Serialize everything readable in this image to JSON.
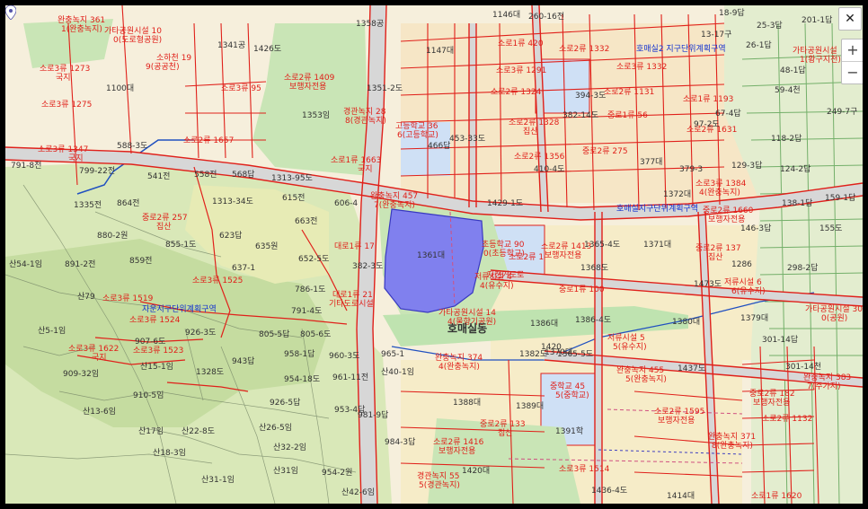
{
  "controls": {
    "close_glyph": "✕",
    "zoom_in_glyph": "+",
    "zoom_out_glyph": "−"
  },
  "colors": {
    "background": "#f6efdc",
    "hill": "#cfe0b0",
    "park": "#bfe3b0",
    "school_site": "#cfe0f5",
    "road_fill": "#e8e8e8",
    "road_line": "#e0201a",
    "selected_parcel": "#8080ee",
    "farmland_line": "#58a050",
    "stream": "#2050c0"
  },
  "labels": [
    {
      "id": "l1",
      "text": "완충녹지 361",
      "style": "red"
    },
    {
      "id": "l2",
      "text": "1(완충녹지)",
      "style": "red"
    },
    {
      "id": "l3",
      "text": "가타공원시설 10",
      "style": "red"
    },
    {
      "id": "l4",
      "text": "0(도로형공원)",
      "style": "red"
    },
    {
      "id": "l5",
      "text": "소로3류 1273",
      "style": "red"
    },
    {
      "id": "l6",
      "text": "국지",
      "style": "red"
    },
    {
      "id": "l7",
      "text": "소하천 19",
      "style": "red"
    },
    {
      "id": "l8",
      "text": "9(공공천)",
      "style": "red"
    },
    {
      "id": "l9",
      "text": "소로3류 1275",
      "style": "red"
    },
    {
      "id": "l10",
      "text": "소로3류 95",
      "style": "red"
    },
    {
      "id": "l11",
      "text": "소로2류 1409",
      "style": "red"
    },
    {
      "id": "l12",
      "text": "보행자전용",
      "style": "red"
    },
    {
      "id": "l13",
      "text": "1341공",
      "style": "dark"
    },
    {
      "id": "l14",
      "text": "1426도",
      "style": "dark"
    },
    {
      "id": "l15",
      "text": "1100대",
      "style": "dark"
    },
    {
      "id": "l16",
      "text": "1358공",
      "style": "dark"
    },
    {
      "id": "l17",
      "text": "1353임",
      "style": "dark"
    },
    {
      "id": "l18",
      "text": "1351-2도",
      "style": "dark"
    },
    {
      "id": "l19",
      "text": "1147대",
      "style": "dark"
    },
    {
      "id": "l20",
      "text": "1146대",
      "style": "dark"
    },
    {
      "id": "l21",
      "text": "260-16전",
      "style": "dark"
    },
    {
      "id": "l22",
      "text": "경관녹지 28",
      "style": "red"
    },
    {
      "id": "l23",
      "text": "8(경관녹지)",
      "style": "red"
    },
    {
      "id": "l24",
      "text": "소로2류 1657",
      "style": "red"
    },
    {
      "id": "l25",
      "text": "소로3류 1347",
      "style": "red"
    },
    {
      "id": "l26",
      "text": "국지",
      "style": "red"
    },
    {
      "id": "l27",
      "text": "588-3도",
      "style": "dark"
    },
    {
      "id": "l28",
      "text": "791-8전",
      "style": "dark"
    },
    {
      "id": "l29",
      "text": "799-22전",
      "style": "dark"
    },
    {
      "id": "l30",
      "text": "541전",
      "style": "dark"
    },
    {
      "id": "l31",
      "text": "558전",
      "style": "dark"
    },
    {
      "id": "l32",
      "text": "568답",
      "style": "dark"
    },
    {
      "id": "l33",
      "text": "1313-95도",
      "style": "dark"
    },
    {
      "id": "l34",
      "text": "1335전",
      "style": "dark"
    },
    {
      "id": "l35",
      "text": "864전",
      "style": "dark"
    },
    {
      "id": "l36",
      "text": "1313-34도",
      "style": "dark"
    },
    {
      "id": "l37",
      "text": "615전",
      "style": "dark"
    },
    {
      "id": "l38",
      "text": "606-4",
      "style": "dark"
    },
    {
      "id": "l39",
      "text": "소로1류 1663",
      "style": "red"
    },
    {
      "id": "l40",
      "text": "국지",
      "style": "red"
    },
    {
      "id": "l41",
      "text": "고등학교 36",
      "style": "red"
    },
    {
      "id": "l42",
      "text": "6(고등학교)",
      "style": "red"
    },
    {
      "id": "l43",
      "text": "완충녹지 457",
      "style": "red"
    },
    {
      "id": "l44",
      "text": "7(완충녹지)",
      "style": "red"
    },
    {
      "id": "l45",
      "text": "중로2류 257",
      "style": "red"
    },
    {
      "id": "l46",
      "text": "집산",
      "style": "red"
    },
    {
      "id": "l47",
      "text": "880-2원",
      "style": "dark"
    },
    {
      "id": "l48",
      "text": "623답",
      "style": "dark"
    },
    {
      "id": "l49",
      "text": "663전",
      "style": "dark"
    },
    {
      "id": "l50",
      "text": "635원",
      "style": "dark"
    },
    {
      "id": "l51",
      "text": "855-1도",
      "style": "dark"
    },
    {
      "id": "l52",
      "text": "산54-1임",
      "style": "dark"
    },
    {
      "id": "l53",
      "text": "891-2전",
      "style": "dark"
    },
    {
      "id": "l54",
      "text": "859전",
      "style": "dark"
    },
    {
      "id": "l55",
      "text": "소로3류 1525",
      "style": "red"
    },
    {
      "id": "l56",
      "text": "652-5도",
      "style": "dark"
    },
    {
      "id": "l57",
      "text": "637-1",
      "style": "dark"
    },
    {
      "id": "l58",
      "text": "대로1류 17",
      "style": "red"
    },
    {
      "id": "l59",
      "text": "382-3도",
      "style": "dark"
    },
    {
      "id": "l60",
      "text": "1361대",
      "style": "dark"
    },
    {
      "id": "l61",
      "text": "초등학교 90",
      "style": "red"
    },
    {
      "id": "l62",
      "text": "0(초등학교)",
      "style": "red"
    },
    {
      "id": "l63",
      "text": "소로2류 1413",
      "style": "red"
    },
    {
      "id": "l64",
      "text": "보행자전용",
      "style": "red"
    },
    {
      "id": "l65",
      "text": "1371대",
      "style": "dark"
    },
    {
      "id": "l66",
      "text": "중로2류 137",
      "style": "red"
    },
    {
      "id": "l67",
      "text": "집산",
      "style": "red"
    },
    {
      "id": "l68",
      "text": "자전거도로",
      "style": "red"
    },
    {
      "id": "l69",
      "text": "저류시설 4",
      "style": "red"
    },
    {
      "id": "l70",
      "text": "4(유수지)",
      "style": "red"
    },
    {
      "id": "l71",
      "text": "저류시설 6",
      "style": "red"
    },
    {
      "id": "l72",
      "text": "6(유수지)",
      "style": "red"
    },
    {
      "id": "l73",
      "text": "중로1류 100",
      "style": "red"
    },
    {
      "id": "l74",
      "text": "1368도",
      "style": "dark"
    },
    {
      "id": "l75",
      "text": "산79",
      "style": "dark"
    },
    {
      "id": "l76",
      "text": "소로3류 1519",
      "style": "red"
    },
    {
      "id": "l77",
      "text": "자운지구단위계획구역",
      "style": "blue"
    },
    {
      "id": "l78",
      "text": "소로3류 1524",
      "style": "red"
    },
    {
      "id": "l79",
      "text": "786-1도",
      "style": "dark"
    },
    {
      "id": "l80",
      "text": "대로1류 21",
      "style": "red"
    },
    {
      "id": "l81",
      "text": "기타도로시설",
      "style": "red"
    },
    {
      "id": "l82",
      "text": "791-4도",
      "style": "dark"
    },
    {
      "id": "l83",
      "text": "가타공원시설 14",
      "style": "red"
    },
    {
      "id": "l84",
      "text": "4(물향기공원)",
      "style": "red"
    },
    {
      "id": "l85",
      "text": "1386대",
      "style": "dark"
    },
    {
      "id": "l86",
      "text": "1380대",
      "style": "dark"
    },
    {
      "id": "l87",
      "text": "1379대",
      "style": "dark"
    },
    {
      "id": "l88",
      "text": "가타공원시설 30",
      "style": "red"
    },
    {
      "id": "l89",
      "text": "0(공원)",
      "style": "red"
    },
    {
      "id": "l90",
      "text": "호매실동",
      "style": "place"
    },
    {
      "id": "l91",
      "text": "산5-1임",
      "style": "dark"
    },
    {
      "id": "l92",
      "text": "805-5답",
      "style": "dark"
    },
    {
      "id": "l93",
      "text": "805-6도",
      "style": "dark"
    },
    {
      "id": "l94",
      "text": "926-3도",
      "style": "dark"
    },
    {
      "id": "l95",
      "text": "소로3류 1622",
      "style": "red"
    },
    {
      "id": "l96",
      "text": "소로3류 1523",
      "style": "red"
    },
    {
      "id": "l97",
      "text": "국지",
      "style": "red"
    },
    {
      "id": "l98",
      "text": "907-6도",
      "style": "dark"
    },
    {
      "id": "l99",
      "text": "909-32임",
      "style": "dark"
    },
    {
      "id": "l100",
      "text": "산15-1임",
      "style": "dark"
    },
    {
      "id": "l101",
      "text": "1328도",
      "style": "dark"
    },
    {
      "id": "l102",
      "text": "943답",
      "style": "dark"
    },
    {
      "id": "l103",
      "text": "958-1답",
      "style": "dark"
    },
    {
      "id": "l104",
      "text": "960-3도",
      "style": "dark"
    },
    {
      "id": "l105",
      "text": "965-1",
      "style": "dark"
    },
    {
      "id": "l106",
      "text": "954-18도",
      "style": "dark"
    },
    {
      "id": "l107",
      "text": "961-11전",
      "style": "dark"
    },
    {
      "id": "l108",
      "text": "산40-1임",
      "style": "dark"
    },
    {
      "id": "l109",
      "text": "완충녹지 374",
      "style": "red"
    },
    {
      "id": "l110",
      "text": "4(완충녹지)",
      "style": "red"
    },
    {
      "id": "l111",
      "text": "완충녹지 455",
      "style": "red"
    },
    {
      "id": "l112",
      "text": "5(완충녹지)",
      "style": "red"
    },
    {
      "id": "l113",
      "text": "1437도",
      "style": "dark"
    },
    {
      "id": "l114",
      "text": "910-5임",
      "style": "dark"
    },
    {
      "id": "l115",
      "text": "산13-6임",
      "style": "dark"
    },
    {
      "id": "l116",
      "text": "산17임",
      "style": "dark"
    },
    {
      "id": "l117",
      "text": "산22-8도",
      "style": "dark"
    },
    {
      "id": "l118",
      "text": "산18-3임",
      "style": "dark"
    },
    {
      "id": "l119",
      "text": "산26-5임",
      "style": "dark"
    },
    {
      "id": "l120",
      "text": "산32-2임",
      "style": "dark"
    },
    {
      "id": "l121",
      "text": "926-5답",
      "style": "dark"
    },
    {
      "id": "l122",
      "text": "953-4답",
      "style": "dark"
    },
    {
      "id": "l123",
      "text": "981-9답",
      "style": "dark"
    },
    {
      "id": "l124",
      "text": "984-3답",
      "style": "dark"
    },
    {
      "id": "l125",
      "text": "1388대",
      "style": "dark"
    },
    {
      "id": "l126",
      "text": "1389대",
      "style": "dark"
    },
    {
      "id": "l127",
      "text": "중학교 45",
      "style": "red"
    },
    {
      "id": "l128",
      "text": "5(중학교)",
      "style": "red"
    },
    {
      "id": "l129",
      "text": "1391학",
      "style": "dark"
    },
    {
      "id": "l130",
      "text": "소로2류 1595",
      "style": "red"
    },
    {
      "id": "l131",
      "text": "보행자전용",
      "style": "red"
    },
    {
      "id": "l132",
      "text": "중로2류 133",
      "style": "red"
    },
    {
      "id": "l133",
      "text": "집산",
      "style": "red"
    },
    {
      "id": "l134",
      "text": "소로2류 1416",
      "style": "red"
    },
    {
      "id": "l135",
      "text": "보행자전용",
      "style": "red"
    },
    {
      "id": "l136",
      "text": "경관녹지 55",
      "style": "red"
    },
    {
      "id": "l137",
      "text": "5(경관녹지)",
      "style": "red"
    },
    {
      "id": "l138",
      "text": "1420대",
      "style": "dark"
    },
    {
      "id": "l139",
      "text": "산31임",
      "style": "dark"
    },
    {
      "id": "l140",
      "text": "산31-1임",
      "style": "dark"
    },
    {
      "id": "l141",
      "text": "954-2원",
      "style": "dark"
    },
    {
      "id": "l142",
      "text": "산42-6임",
      "style": "dark"
    },
    {
      "id": "l143",
      "text": "소로3류 1514",
      "style": "red"
    },
    {
      "id": "l144",
      "text": "1436-4도",
      "style": "dark"
    },
    {
      "id": "l145",
      "text": "1414대",
      "style": "dark"
    },
    {
      "id": "l146",
      "text": "완충녹지 371",
      "style": "red"
    },
    {
      "id": "l147",
      "text": "8(완충녹지)",
      "style": "red"
    },
    {
      "id": "l148",
      "text": "중로2류 182",
      "style": "red"
    },
    {
      "id": "l149",
      "text": "보행자전용",
      "style": "red"
    },
    {
      "id": "l150",
      "text": "소로1류 1620",
      "style": "red"
    },
    {
      "id": "l151",
      "text": "소로2류 1132",
      "style": "red"
    },
    {
      "id": "l152",
      "text": "1429-1도",
      "style": "dark"
    },
    {
      "id": "l153",
      "text": "중로2류 1660",
      "style": "red"
    },
    {
      "id": "l154",
      "text": "보행자전용",
      "style": "red"
    },
    {
      "id": "l155",
      "text": "호매실지구단위계획구역",
      "style": "blue"
    },
    {
      "id": "l156",
      "text": "소로3류 1384",
      "style": "red"
    },
    {
      "id": "l157",
      "text": "4(완충녹지)",
      "style": "red"
    },
    {
      "id": "l158",
      "text": "소로2류 1631",
      "style": "red"
    },
    {
      "id": "l159",
      "text": "377대",
      "style": "dark"
    },
    {
      "id": "l160",
      "text": "중로2류 275",
      "style": "red"
    },
    {
      "id": "l161",
      "text": "소로2류 1356",
      "style": "red"
    },
    {
      "id": "l162",
      "text": "소로2류 1328",
      "style": "red"
    },
    {
      "id": "l163",
      "text": "집산",
      "style": "red"
    },
    {
      "id": "l164",
      "text": "소로2류 1324",
      "style": "red"
    },
    {
      "id": "l165",
      "text": "소로3류 1291",
      "style": "red"
    },
    {
      "id": "l166",
      "text": "소로1류 420",
      "style": "red"
    },
    {
      "id": "l167",
      "text": "호매실2 지구단위계획구역",
      "style": "blue"
    },
    {
      "id": "l168",
      "text": "소로2류 1332",
      "style": "red"
    },
    {
      "id": "l169",
      "text": "소로3류 1332",
      "style": "red"
    },
    {
      "id": "l170",
      "text": "소로2류 1131",
      "style": "red"
    },
    {
      "id": "l171",
      "text": "중로1류 56",
      "style": "red"
    },
    {
      "id": "l172",
      "text": "소로1류 1193",
      "style": "red"
    },
    {
      "id": "l173",
      "text": "18-9답",
      "style": "dark"
    },
    {
      "id": "l174",
      "text": "25-3답",
      "style": "dark"
    },
    {
      "id": "l175",
      "text": "201-1답",
      "style": "dark"
    },
    {
      "id": "l176",
      "text": "13-17구",
      "style": "dark"
    },
    {
      "id": "l177",
      "text": "26-1답",
      "style": "dark"
    },
    {
      "id": "l178",
      "text": "가타공원시설",
      "style": "red"
    },
    {
      "id": "l179",
      "text": "1(황구지천)",
      "style": "red"
    },
    {
      "id": "l180",
      "text": "48-1답",
      "style": "dark"
    },
    {
      "id": "l181",
      "text": "59-4천",
      "style": "dark"
    },
    {
      "id": "l182",
      "text": "67-4답",
      "style": "dark"
    },
    {
      "id": "l183",
      "text": "249-7구",
      "style": "dark"
    },
    {
      "id": "l184",
      "text": "118-2답",
      "style": "dark"
    },
    {
      "id": "l185",
      "text": "124-2답",
      "style": "dark"
    },
    {
      "id": "l186",
      "text": "129-3답",
      "style": "dark"
    },
    {
      "id": "l187",
      "text": "159-1답",
      "style": "dark"
    },
    {
      "id": "l188",
      "text": "138-1답",
      "style": "dark"
    },
    {
      "id": "l189",
      "text": "155도",
      "style": "dark"
    },
    {
      "id": "l190",
      "text": "146-3답",
      "style": "dark"
    },
    {
      "id": "l191",
      "text": "298-2답",
      "style": "dark"
    },
    {
      "id": "l192",
      "text": "301-14답",
      "style": "dark"
    },
    {
      "id": "l193",
      "text": "301-14천",
      "style": "dark"
    },
    {
      "id": "l194",
      "text": "완충녹지 383",
      "style": "red"
    },
    {
      "id": "l195",
      "text": "7(주가지)",
      "style": "red"
    },
    {
      "id": "l196",
      "text": "소로2류 1",
      "style": "red"
    },
    {
      "id": "l197",
      "text": "저류시설 5",
      "style": "red"
    },
    {
      "id": "l198",
      "text": "5(유수지)",
      "style": "red"
    },
    {
      "id": "l199",
      "text": "1386-4도",
      "style": "dark"
    },
    {
      "id": "l200",
      "text": "1365-4도",
      "style": "dark"
    },
    {
      "id": "l201",
      "text": "1370대",
      "style": "dark"
    },
    {
      "id": "l202",
      "text": "1420",
      "style": "dark"
    },
    {
      "id": "l203",
      "text": "1365-5도",
      "style": "dark"
    },
    {
      "id": "l204",
      "text": "453-33도",
      "style": "dark"
    },
    {
      "id": "l205",
      "text": "394-3도",
      "style": "dark"
    },
    {
      "id": "l206",
      "text": "382-14도",
      "style": "dark"
    },
    {
      "id": "l207",
      "text": "410-4도",
      "style": "dark"
    },
    {
      "id": "l208",
      "text": "466답",
      "style": "dark"
    },
    {
      "id": "l209",
      "text": "379-3",
      "style": "dark"
    },
    {
      "id": "l210",
      "text": "97-2도",
      "style": "dark"
    },
    {
      "id": "l211",
      "text": "1372대",
      "style": "dark"
    },
    {
      "id": "l212",
      "text": "1473도",
      "style": "dark"
    },
    {
      "id": "l213",
      "text": "1286",
      "style": "dark"
    },
    {
      "id": "l214",
      "text": "1382도",
      "style": "dark"
    }
  ]
}
